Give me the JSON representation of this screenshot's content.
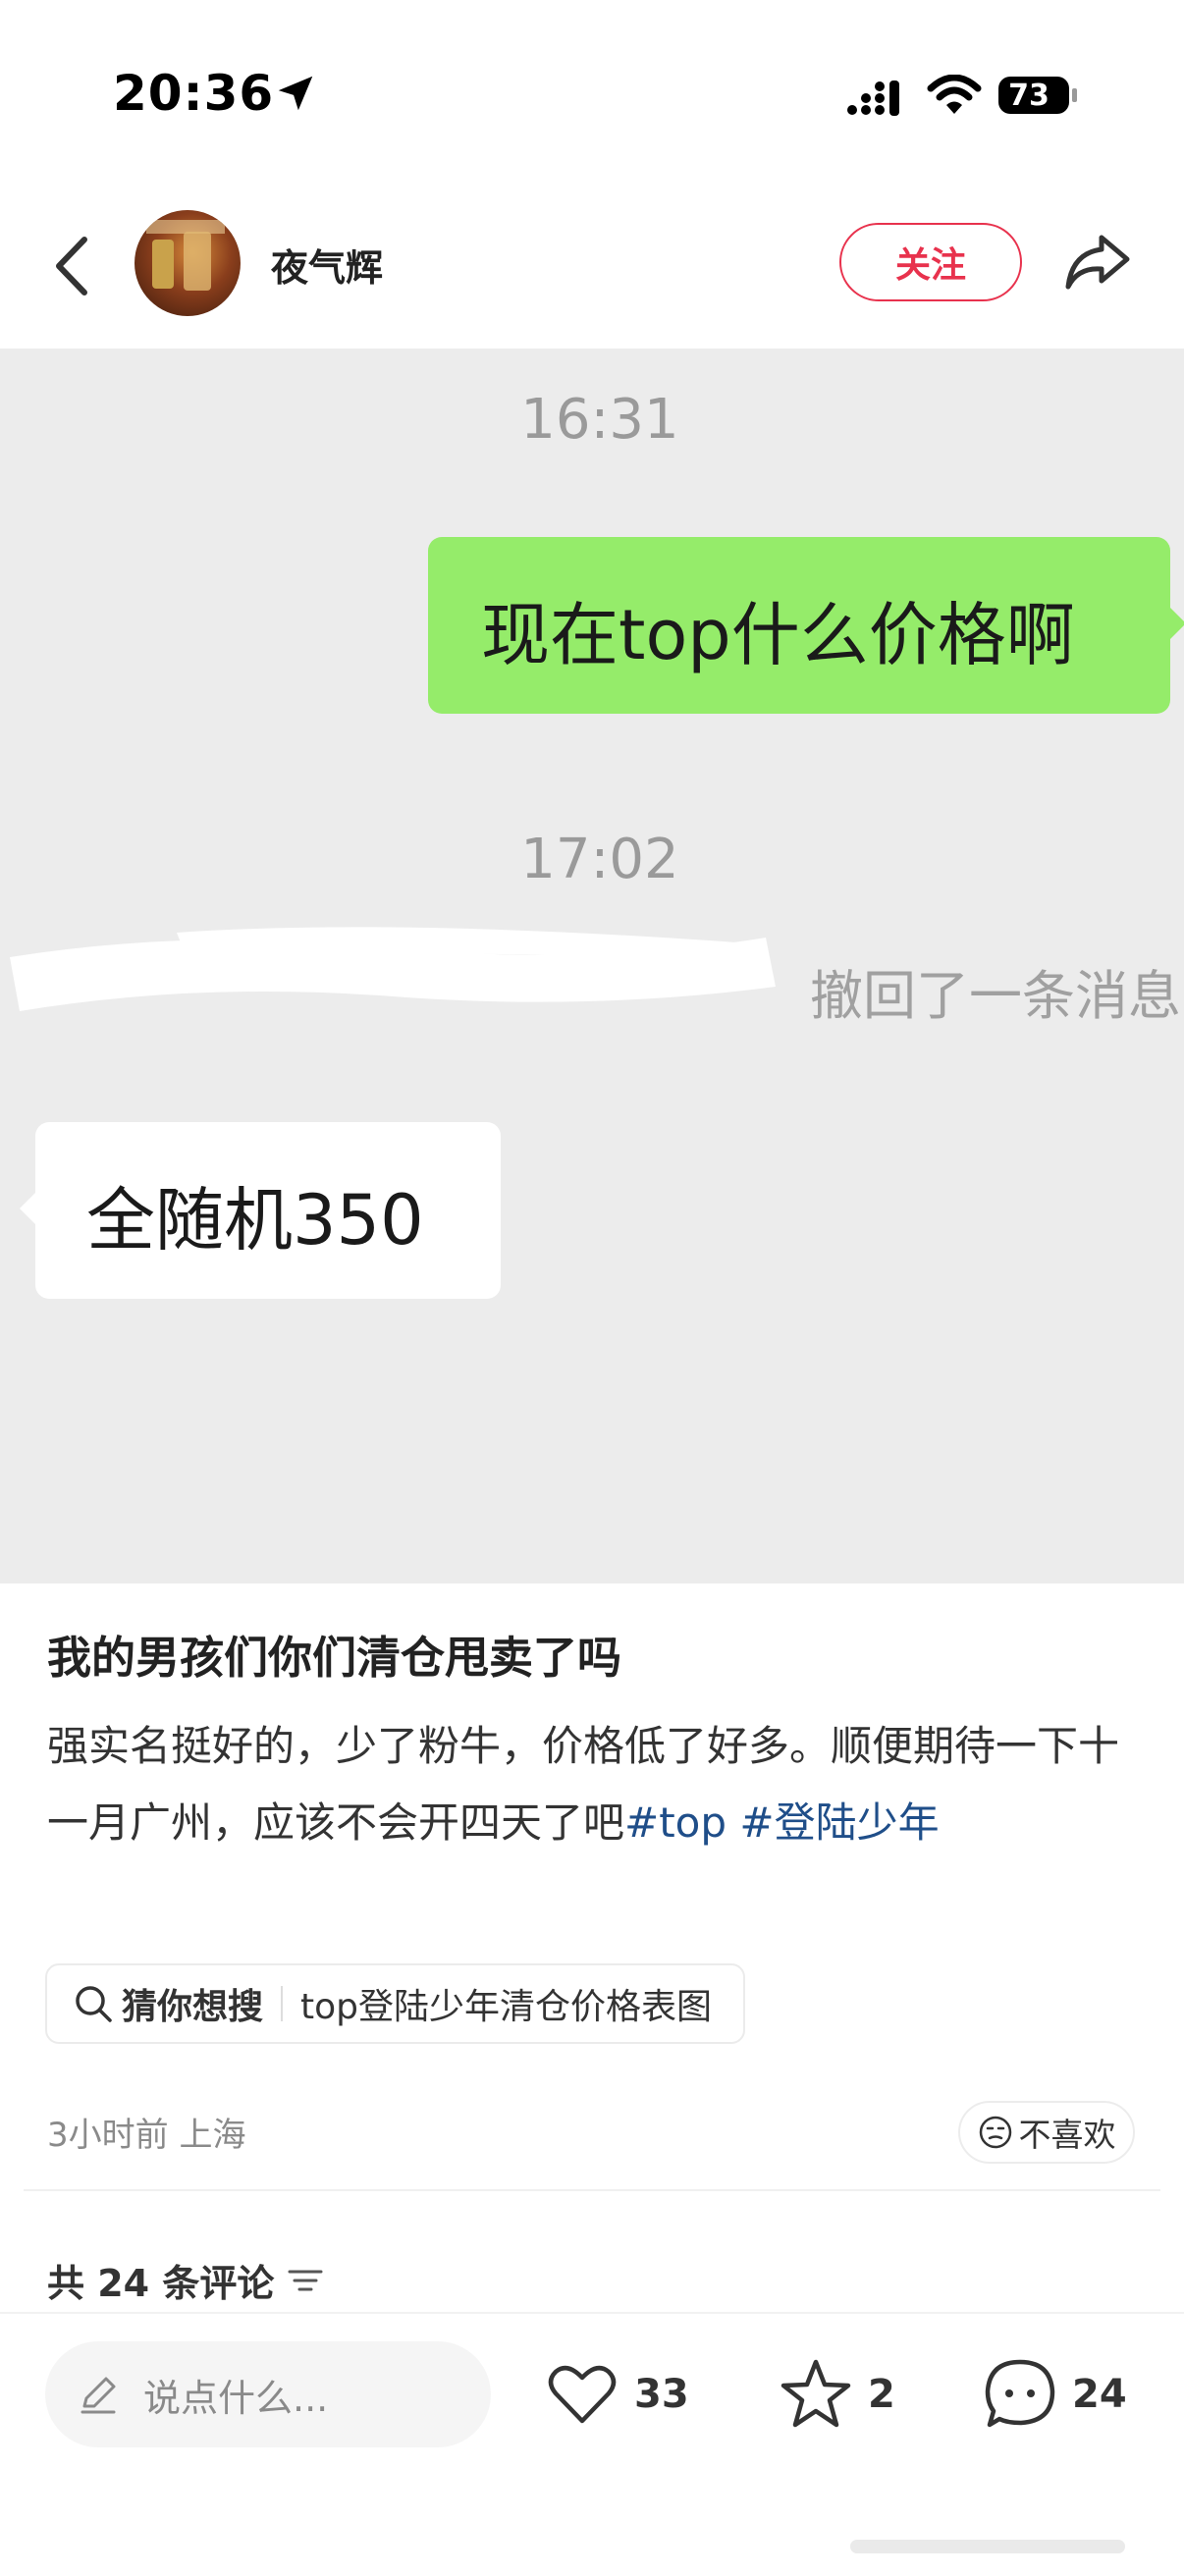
{
  "status_bar": {
    "time": "20:36",
    "battery": "73"
  },
  "header": {
    "username": "夜气辉",
    "follow_label": "关注"
  },
  "chat_image": {
    "time_1": "16:31",
    "sent_message": "现在top什么价格啊",
    "time_2": "17:02",
    "recall_notice": "撤回了一条消息",
    "received_message": "全随机350",
    "bubble_colors": {
      "sent": "#95ec6a",
      "received": "#ffffff"
    }
  },
  "post": {
    "title": "我的男孩们你们清仓甩卖了吗",
    "body_text": "强实名挺好的，少了粉牛，价格低了好多。顺便期待一下十一月广州，应该不会开四天了吧",
    "tags": [
      "#top",
      "#登陆少年"
    ],
    "search_label": "猜你想搜",
    "search_query": "top登陆少年清仓价格表图",
    "meta": "3小时前 上海",
    "dislike_label": "不喜欢",
    "comment_count_label": "共 24 条评论"
  },
  "bottom_bar": {
    "input_placeholder": "说点什么...",
    "likes": "33",
    "favorites": "2",
    "comments": "24"
  },
  "colors": {
    "accent": "#e8324d",
    "tag": "#1f4e89"
  },
  "icons": [
    "location-arrow-icon",
    "signal-icon",
    "wifi-icon",
    "battery-icon",
    "back-arrow-icon",
    "share-icon",
    "search-icon",
    "neutral-face-icon",
    "filter-icon",
    "pencil-icon",
    "heart-icon",
    "star-icon",
    "comment-bubble-icon"
  ]
}
